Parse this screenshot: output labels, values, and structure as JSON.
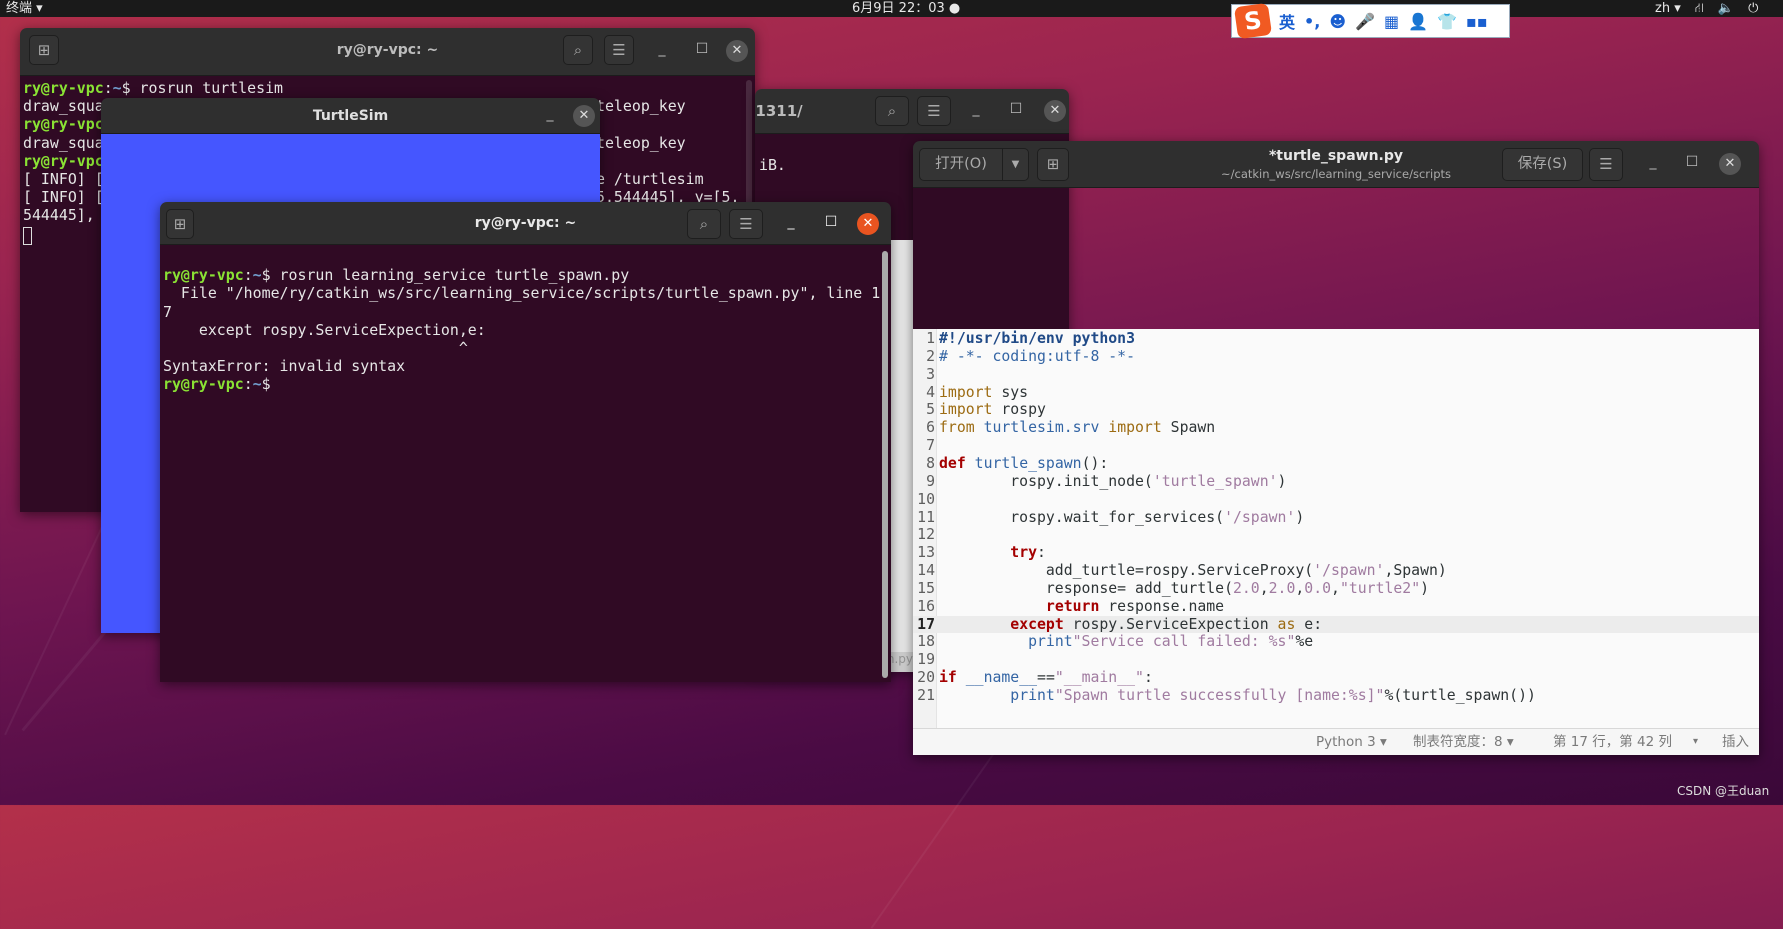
{
  "topbar": {
    "app_menu": "终端 ▾",
    "clock": "6月9日  22：03  ●",
    "lang": "zh ▾",
    "net_icon": "⛙",
    "vol_icon": "🔈",
    "power_icon": "⏻"
  },
  "ime": {
    "logo": "S",
    "mode": "英",
    "punct": "•,",
    "icons": [
      "☻",
      "🎤",
      "▦",
      "👤",
      "👕",
      "▪▪"
    ]
  },
  "term1": {
    "title": "ry@ry-vpc: ~",
    "lines_left": [
      [
        "ry@ry-vpc",
        ":",
        "~",
        "$ rosrun turtlesim"
      ],
      "draw_squa",
      [
        "ry@ry-vpc"
      ],
      "draw_squa",
      [
        "ry@ry-vpc"
      ],
      "[ INFO] [",
      "[ INFO] [",
      "544445], "
    ],
    "lines_right": [
      "",
      "teleop_key",
      "",
      "teleop_key",
      "",
      "e /turtlesim",
      "5.544445], y=[5.",
      ""
    ]
  },
  "term3": {
    "title": "11311/",
    "text": "iB.",
    "strip_text": "n.py"
  },
  "turtlesim": {
    "title": "TurtleSim",
    "bg": "#4556ff"
  },
  "term2": {
    "title": "ry@ry-vpc: ~",
    "user": "ry@ry-vpc",
    "path": "~",
    "cmd": "$ rosrun learning_service turtle_spawn.py",
    "out": [
      "  File \"/home/ry/catkin_ws/src/learning_service/scripts/turtle_spawn.py\", line 1",
      "7",
      "    except rospy.ServiceExpection,e:",
      "                                 ^",
      "SyntaxError: invalid syntax"
    ],
    "prompt_end": "$"
  },
  "gedit": {
    "open": "打开(O)",
    "title": "*turtle_spawn.py",
    "path": "~/catkin_ws/src/learning_service/scripts",
    "save": "保存(S)",
    "current_line": 17,
    "lines": [
      [
        [
          "#!/usr/bin/env python3",
          "she"
        ]
      ],
      [
        [
          "# -*- coding:utf-8 -*-",
          "cm"
        ]
      ],
      [],
      [
        [
          "import",
          "imp"
        ],
        [
          " sys",
          ""
        ]
      ],
      [
        [
          "import",
          "imp"
        ],
        [
          " rospy",
          ""
        ]
      ],
      [
        [
          "from",
          "imp"
        ],
        [
          " ",
          ""
        ],
        [
          "turtlesim.srv",
          "id"
        ],
        [
          " ",
          ""
        ],
        [
          "import",
          "imp"
        ],
        [
          " Spawn",
          ""
        ]
      ],
      [],
      [
        [
          "def",
          "kw"
        ],
        [
          " ",
          ""
        ],
        [
          "turtle_spawn",
          "id"
        ],
        [
          "():",
          ""
        ]
      ],
      [
        [
          "        rospy.init_node(",
          ""
        ],
        [
          "'turtle_spawn'",
          "str"
        ],
        [
          ")",
          ""
        ]
      ],
      [],
      [
        [
          "        rospy.wait_for_services(",
          ""
        ],
        [
          "'/spawn'",
          "str"
        ],
        [
          ")",
          ""
        ]
      ],
      [],
      [
        [
          "        ",
          ""
        ],
        [
          "try",
          "kw"
        ],
        [
          ":",
          ""
        ]
      ],
      [
        [
          "            add_turtle=rospy.ServiceProxy(",
          ""
        ],
        [
          "'/spawn'",
          "str"
        ],
        [
          ",Spawn)",
          ""
        ]
      ],
      [
        [
          "            response= add_turtle(",
          ""
        ],
        [
          "2.0",
          "num"
        ],
        [
          ",",
          ""
        ],
        [
          "2.0",
          "num"
        ],
        [
          ",",
          ""
        ],
        [
          "0.0",
          "num"
        ],
        [
          ",",
          ""
        ],
        [
          "\"turtle2\"",
          "str"
        ],
        [
          ")",
          ""
        ]
      ],
      [
        [
          "            ",
          ""
        ],
        [
          "return",
          "kw"
        ],
        [
          " response.name",
          ""
        ]
      ],
      [
        [
          "        ",
          ""
        ],
        [
          "except",
          "kw"
        ],
        [
          " rospy.ServiceExpection ",
          ""
        ],
        [
          "as",
          "imp"
        ],
        [
          " e:",
          ""
        ]
      ],
      [
        [
          "          ",
          ""
        ],
        [
          "print",
          "bi"
        ],
        [
          "\"Service call failed: %s\"",
          "str"
        ],
        [
          "%e",
          ""
        ]
      ],
      [],
      [
        [
          "if",
          "kw"
        ],
        [
          " ",
          ""
        ],
        [
          "__name__",
          "id"
        ],
        [
          "==",
          ""
        ],
        [
          "\"__main__\"",
          "str"
        ],
        [
          ":",
          ""
        ]
      ],
      [
        [
          "        ",
          ""
        ],
        [
          "print",
          "bi"
        ],
        [
          "\"Spawn turtle successfully [name:%s]\"",
          "str"
        ],
        [
          "%(turtle_spawn())",
          ""
        ]
      ]
    ],
    "status": {
      "lang": "Python 3 ▾",
      "tab": "制表符宽度：8 ▾",
      "pos": "第 17 行，第 42 列",
      "pos_menu": "▾",
      "mode": "插入"
    }
  },
  "watermark": "CSDN @王duan"
}
